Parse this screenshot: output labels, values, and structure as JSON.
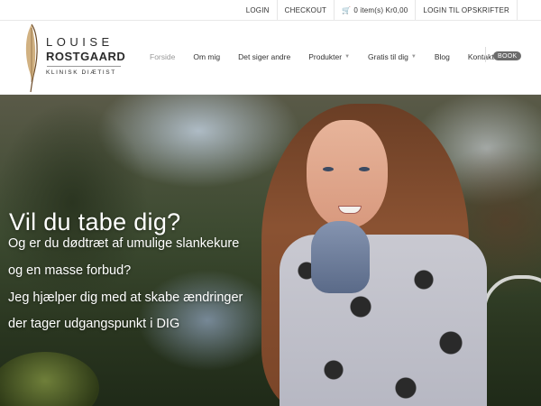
{
  "topbar": {
    "login": "LOGIN",
    "checkout": "CHECKOUT",
    "cart": "0 item(s) Kr0,00",
    "login_recipes": "LOGIN TIL OPSKRIFTER"
  },
  "logo": {
    "name_first": "LOUISE",
    "name_last": "ROSTGAARD",
    "subtitle": "KLINISK DIÆTIST"
  },
  "nav": {
    "items": [
      {
        "label": "Forside",
        "active": true
      },
      {
        "label": "Om mig"
      },
      {
        "label": "Det siger andre"
      },
      {
        "label": "Produkter",
        "dropdown": true
      },
      {
        "label": "Gratis til dig",
        "dropdown": true
      },
      {
        "label": "Blog"
      },
      {
        "label": "Kontakt"
      }
    ],
    "book": "BOOK"
  },
  "hero": {
    "title": "Vil du tabe dig?",
    "lines": [
      "Og er du dødtræt af umulige slankekure",
      "og en masse forbud?",
      "Jeg hjælper dig med at skabe ændringer",
      "der tager udgangspunkt i DIG"
    ]
  },
  "colors": {
    "book_bg": "#6b6b6b",
    "nav_active": "#999999",
    "text": "#333333"
  },
  "icons": [
    "cart-icon",
    "feather-icon",
    "chevron-down-icon"
  ]
}
